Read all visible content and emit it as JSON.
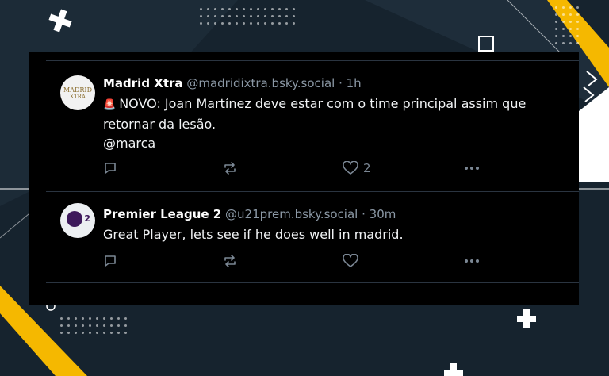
{
  "posts": [
    {
      "avatar_lines": [
        "MADRID",
        "XTRA"
      ],
      "name": "Madrid Xtra",
      "handle": "@madridixtra.bsky.social",
      "time": "1h",
      "lines": [
        "NOVO: Joan Martínez deve estar com o time principal assim que",
        "retornar da lesão.",
        "@marca"
      ],
      "siren": "🚨",
      "like_count": "2"
    },
    {
      "avatar_number": "2",
      "name": "Premier League 2",
      "handle": "@u21prem.bsky.social",
      "time": "30m",
      "lines": [
        "Great Player, lets see if he does well in madrid."
      ],
      "like_count": ""
    }
  ],
  "separator": " · ",
  "icons": [
    "reply-icon",
    "repost-icon",
    "like-icon",
    "more-icon"
  ],
  "colors": {
    "panel": "#000000",
    "accent_yellow": "#f5b800",
    "muted": "#7b8794"
  }
}
